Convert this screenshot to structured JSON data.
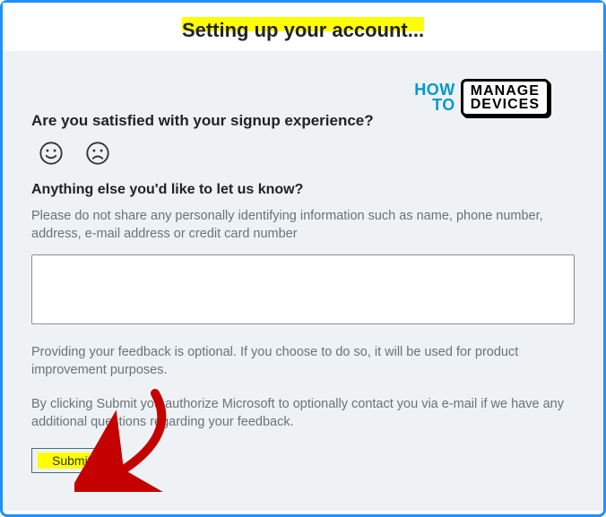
{
  "header": {
    "title": "Setting up your account..."
  },
  "logo": {
    "how": "HOW",
    "to": "TO",
    "manage": "MANAGE",
    "devices": "DEVICES"
  },
  "feedback": {
    "question_satisfied": "Are you satisfied with your signup experience?",
    "question_anything_else": "Anything else you'd like to let us know?",
    "privacy_hint": "Please do not share any personally identifying information such as name, phone number, address, e-mail address or credit card number",
    "optional_note": "Providing your feedback is optional. If you choose to do so, it will be used for product improvement purposes.",
    "authorize_note": "By clicking Submit you authorize Microsoft to optionally contact you via e-mail if we have any additional questions regarding your feedback.",
    "submit_label": "Submit",
    "textarea_value": ""
  }
}
